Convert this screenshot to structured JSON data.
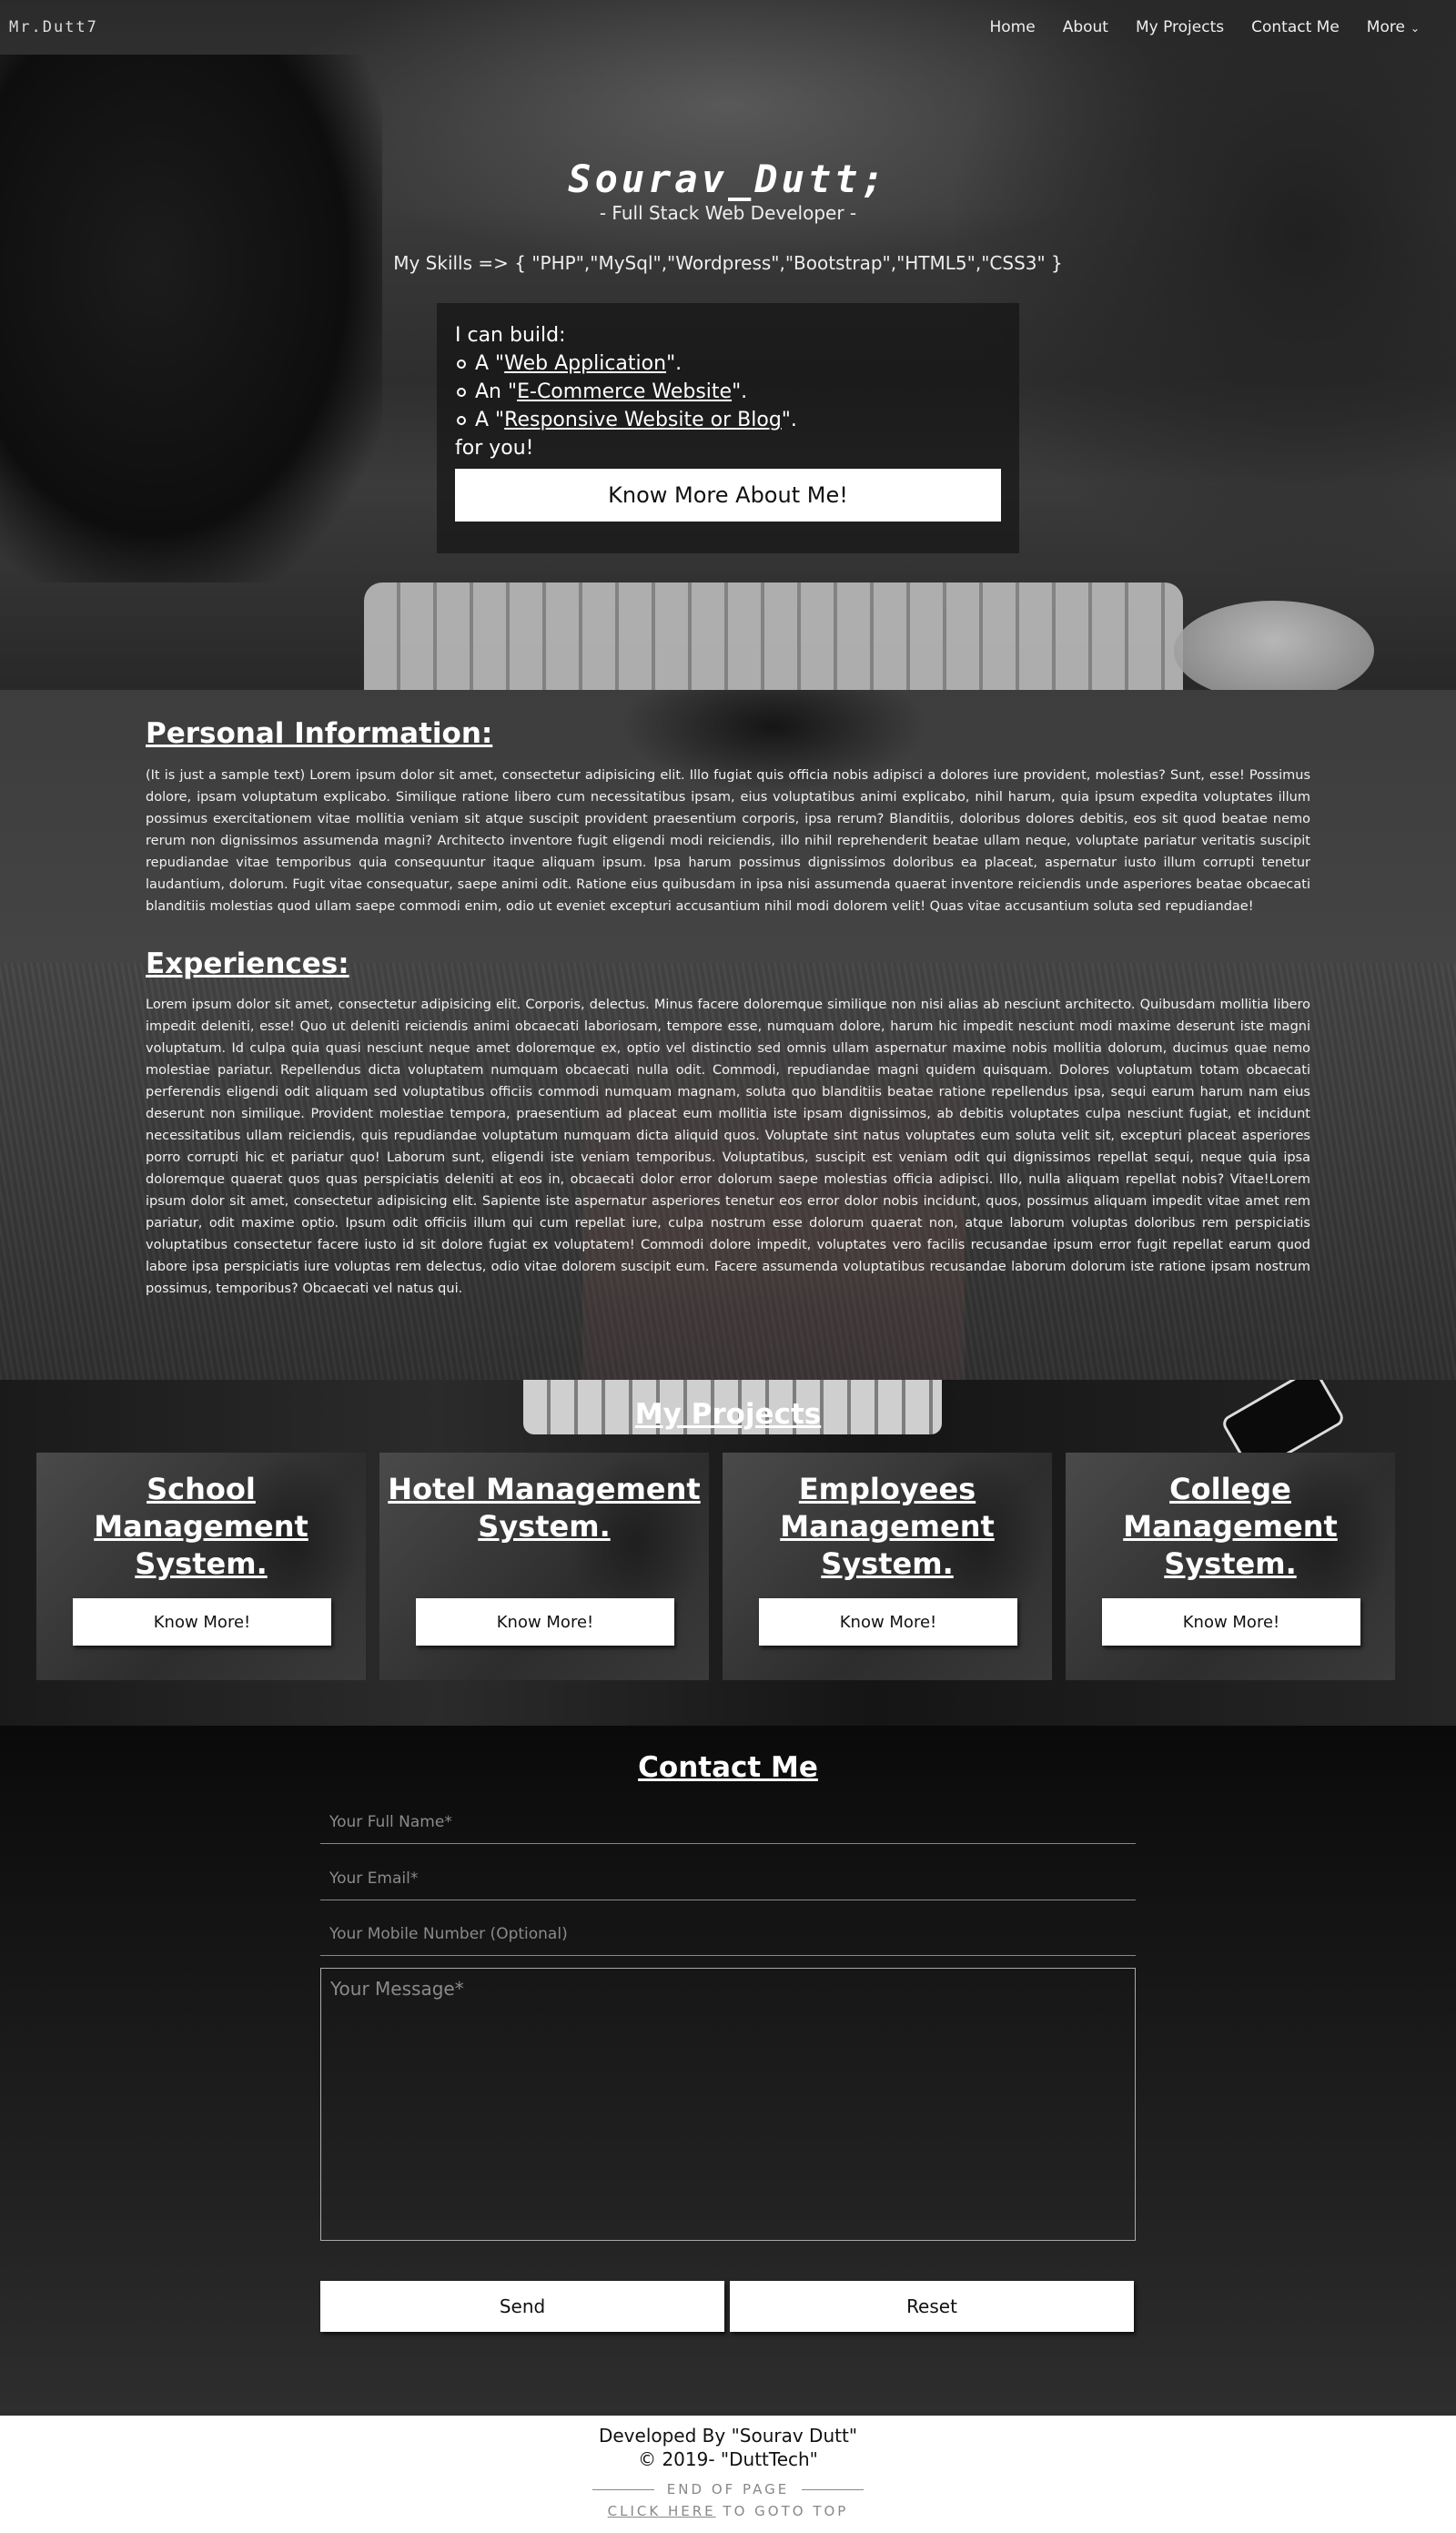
{
  "nav": {
    "brand": "Mr.Dutt7",
    "items": [
      "Home",
      "About",
      "My Projects",
      "Contact Me",
      "More"
    ]
  },
  "hero": {
    "name": "Sourav_Dutt;",
    "role": "- Full Stack Web Developer -",
    "skills": "My Skills => { \"PHP\",\"MySql\",\"Wordpress\",\"Bootstrap\",\"HTML5\",\"CSS3\" }",
    "build_intro": "I can build:",
    "build_items": [
      {
        "prefix": "A \"",
        "link": "Web Application",
        "suffix": "\"."
      },
      {
        "prefix": "An \"",
        "link": "E-Commerce Website",
        "suffix": "\"."
      },
      {
        "prefix": "A \"",
        "link": "Responsive Website or Blog",
        "suffix": "\"."
      }
    ],
    "build_outro": "for you!",
    "know_more": "Know More About Me!"
  },
  "about": {
    "personal_heading": "Personal Information:",
    "personal_text": "(It is just a sample text) Lorem ipsum dolor sit amet, consectetur adipisicing elit. Illo fugiat quis officia nobis adipisci a dolores iure provident, molestias? Sunt, esse! Possimus dolore, ipsam voluptatum explicabo. Similique ratione libero cum necessitatibus ipsam, eius voluptatibus animi explicabo, nihil harum, quia ipsum expedita voluptates illum possimus exercitationem vitae mollitia veniam sit atque suscipit provident praesentium corporis, ipsa rerum? Blanditiis, doloribus dolores debitis, eos sit quod beatae nemo rerum non dignissimos assumenda magni? Architecto inventore fugit eligendi modi reiciendis, illo nihil reprehenderit beatae ullam neque, voluptate pariatur veritatis suscipit repudiandae vitae temporibus quia consequuntur itaque aliquam ipsum. Ipsa harum possimus dignissimos doloribus ea placeat, aspernatur iusto illum corrupti tenetur laudantium, dolorum. Fugit vitae consequatur, saepe animi odit. Ratione eius quibusdam in ipsa nisi assumenda quaerat inventore reiciendis unde asperiores beatae obcaecati blanditiis molestias quod ullam saepe commodi enim, odio ut eveniet excepturi accusantium nihil modi dolorem velit! Quas vitae accusantium soluta sed repudiandae!",
    "experience_heading": "Experiences:",
    "experience_text": "Lorem ipsum dolor sit amet, consectetur adipisicing elit. Corporis, delectus. Minus facere doloremque similique non nisi alias ab nesciunt architecto. Quibusdam mollitia libero impedit deleniti, esse! Quo ut deleniti reiciendis animi obcaecati laboriosam, tempore esse, numquam dolore, harum hic impedit nesciunt modi maxime deserunt iste magni voluptatum. Id culpa quia quasi nesciunt neque amet doloremque ex, optio vel distinctio sed omnis ullam aspernatur maxime nobis mollitia dolorum, ducimus quae nemo molestiae pariatur. Repellendus dicta voluptatem numquam obcaecati nulla odit. Commodi, repudiandae magni quidem quisquam. Dolores voluptatum totam obcaecati perferendis eligendi odit aliquam sed voluptatibus officiis commodi numquam magnam, soluta quo blanditiis beatae ratione repellendus ipsa, sequi earum harum nam eius deserunt non similique. Provident molestiae tempora, praesentium ad placeat eum mollitia iste ipsam dignissimos, ab debitis voluptates culpa nesciunt fugiat, et incidunt necessitatibus ullam reiciendis, quis repudiandae voluptatum numquam dicta aliquid quos. Voluptate sint natus voluptates eum soluta velit sit, excepturi placeat asperiores porro corrupti hic et pariatur quo! Laborum sunt, eligendi iste veniam temporibus. Voluptatibus, suscipit est veniam odit qui dignissimos repellat sequi, neque quia ipsa doloremque quaerat quos quas perspiciatis deleniti at eos in, obcaecati dolor error dolorum saepe molestias officia adipisci. Illo, nulla aliquam repellat nobis? Vitae!Lorem ipsum dolor sit amet, consectetur adipisicing elit. Sapiente iste aspernatur asperiores tenetur eos error dolor nobis incidunt, quos, possimus aliquam impedit vitae amet rem pariatur, odit maxime optio. Ipsum odit officiis illum qui cum repellat iure, culpa nostrum esse dolorum quaerat non, atque laborum voluptas doloribus rem perspiciatis voluptatibus consectetur facere iusto id sit dolore fugiat ex voluptatem! Commodi dolore impedit, voluptates vero facilis recusandae ipsum error fugit repellat earum quod labore ipsa perspiciatis iure voluptas rem delectus, odio vitae dolorem suscipit eum. Facere assumenda voluptatibus recusandae laborum dolorum iste ratione ipsam nostrum possimus, temporibus? Obcaecati vel natus qui."
  },
  "projects": {
    "heading": "My Projects",
    "cards": [
      {
        "title": "School Management System.",
        "button": "Know More!"
      },
      {
        "title": "Hotel Management System.",
        "button": "Know More!"
      },
      {
        "title": "Employees Management System.",
        "button": "Know More!"
      },
      {
        "title": "College Management System.",
        "button": "Know More!"
      }
    ]
  },
  "contact": {
    "heading": "Contact Me",
    "name_placeholder": "Your Full Name*",
    "email_placeholder": "Your Email*",
    "mobile_placeholder": "Your Mobile Number (Optional)",
    "message_placeholder": "Your Message*",
    "send": "Send",
    "reset": "Reset"
  },
  "footer": {
    "developed_by": "Developed By \"Sourav Dutt\"",
    "copyright": "© 2019- \"DuttTech\"",
    "end_of_page": "END OF PAGE",
    "click_here": "CLICK HERE",
    "goto_top": " TO GOTO TOP"
  },
  "colors": {
    "background": "#111111",
    "text": "#ffffff",
    "button_bg": "#ffffff",
    "button_text": "#111111"
  }
}
